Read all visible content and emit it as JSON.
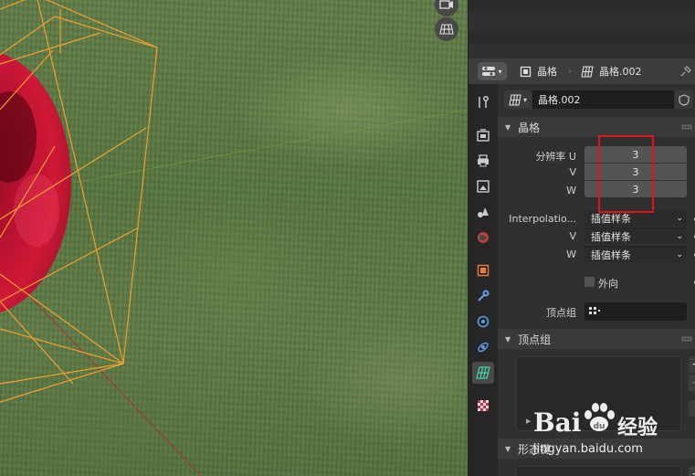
{
  "header": {
    "object_name": "晶格",
    "data_name": "晶格.002"
  },
  "datablock": {
    "name": "晶格.002"
  },
  "lattice_section": {
    "title": "晶格",
    "resolution_u_label": "分辨率 U",
    "resolution_u_value": "3",
    "resolution_v_label": "V",
    "resolution_v_value": "3",
    "resolution_w_label": "W",
    "resolution_w_value": "3",
    "interp_label": "Interpolatio...",
    "interp_u_value": "插值样条",
    "interp_v_label": "V",
    "interp_v_value": "插值样条",
    "interp_w_label": "W",
    "interp_w_value": "插值样条",
    "outside_label": "外向",
    "vertex_group_label": "顶点组"
  },
  "vertex_groups_section": {
    "title": "顶点组",
    "add_label": "+",
    "remove_label": "−"
  },
  "shape_keys_section": {
    "title": "形态键",
    "add_label": "+"
  },
  "watermark": {
    "brand": "Bai",
    "brand2": "du",
    "product": "经验",
    "url": "jingyan.baidu.com"
  },
  "colors": {
    "lattice_wire": "#f0a030",
    "sphere": "#c0102a",
    "highlight_box": "#e0141c",
    "active_tab_icon": "#40d0a0"
  }
}
